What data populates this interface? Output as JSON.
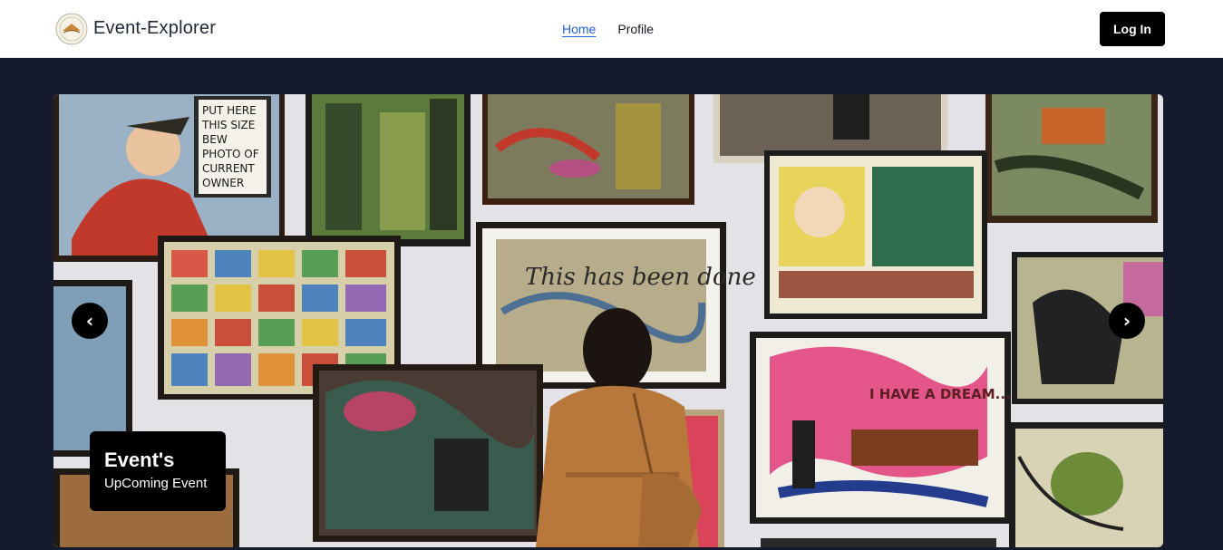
{
  "nav": {
    "brand": "Event-Explorer",
    "logo_icon": "circular-emblem-logo",
    "links": [
      {
        "label": "Home",
        "active": true
      },
      {
        "label": "Profile",
        "active": false
      }
    ],
    "login_label": "Log In"
  },
  "hero": {
    "slide_image": "gallery wall of framed paintings with a woman viewing them",
    "slide_text": {
      "poster": [
        "PUT HERE",
        "THIS SIZE",
        "BEW",
        "PHOTO OF",
        "CURRENT",
        "OWNER"
      ],
      "this_has_been_done": "This has been done",
      "have_a_dream": "I HAVE A DREAM..."
    },
    "prev_icon": "chevron-left-icon",
    "next_icon": "chevron-right-icon",
    "prev_glyph": "‹",
    "next_glyph": "›",
    "caption": {
      "title": "Event's",
      "subtitle": "UpComing Event"
    }
  },
  "colors": {
    "header_bg": "#ffffff",
    "page_bg": "#151b2c",
    "active_link": "#2563eb",
    "button_bg": "#000000"
  }
}
